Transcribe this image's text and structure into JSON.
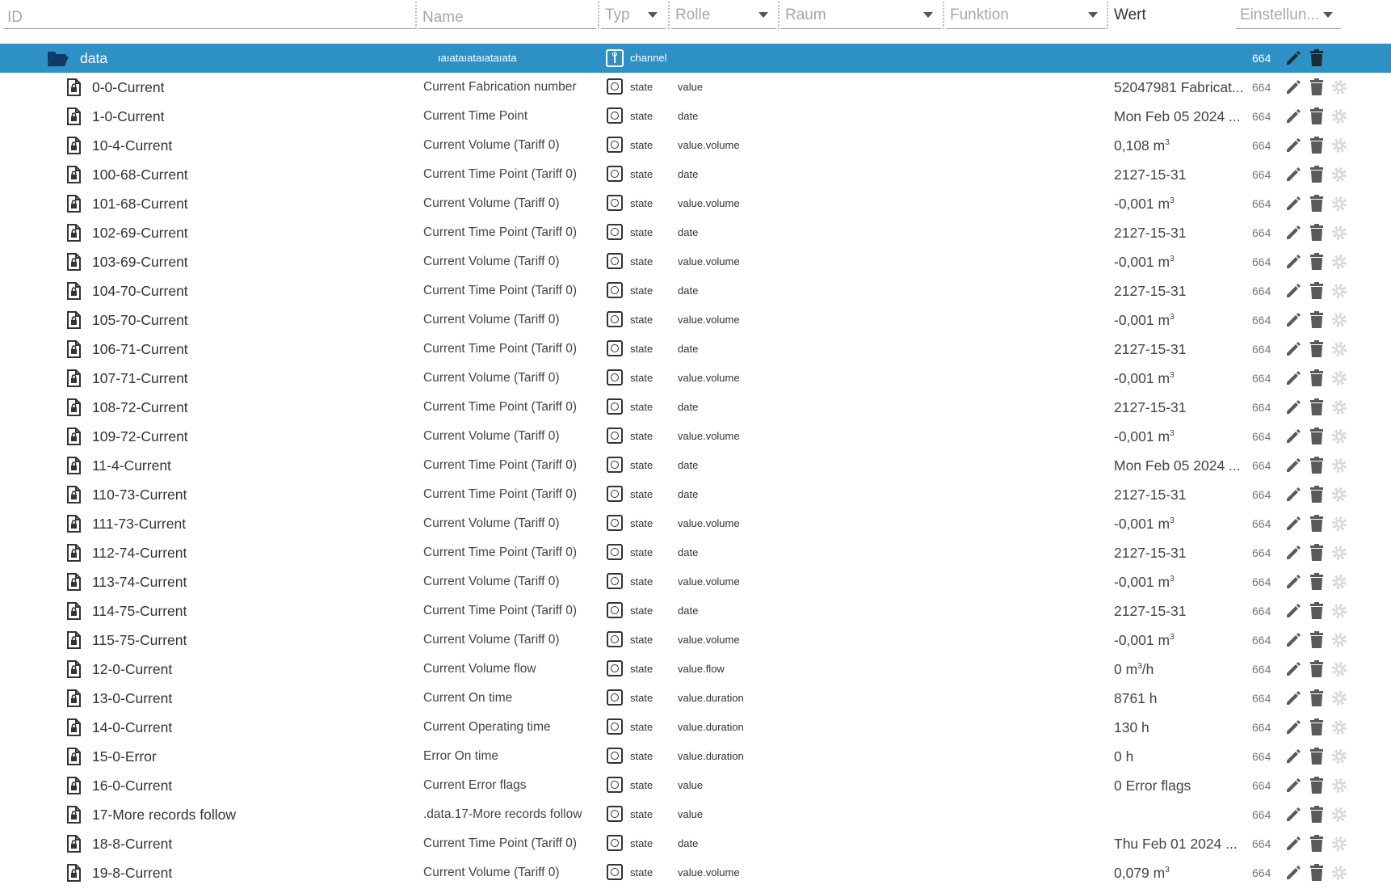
{
  "filters": {
    "id_placeholder": "ID",
    "name_placeholder": "Name",
    "type_label": "Typ",
    "role_label": "Rolle",
    "room_label": "Raum",
    "function_label": "Funktion",
    "value_label": "Wert",
    "settings_label": "Einstellun..."
  },
  "colors": {
    "selected_row": "#2e91c6",
    "icon_dark": "#333333",
    "icon_gear": "#d9d9d9"
  },
  "channel_row": {
    "id": "data",
    "name": "ıaıataıataıataıata",
    "type": "channel",
    "acl": "664"
  },
  "rows": [
    {
      "id": "0-0-Current",
      "name": "Current Fabrication number",
      "type": "state",
      "role": "value",
      "value": "52047981 Fabricat...",
      "unit": "",
      "acl": "664"
    },
    {
      "id": "1-0-Current",
      "name": "Current Time Point",
      "type": "state",
      "role": "date",
      "value": "Mon Feb 05 2024 ...",
      "unit": "",
      "acl": "664"
    },
    {
      "id": "10-4-Current",
      "name": "Current Volume (Tariff 0)",
      "type": "state",
      "role": "value.volume",
      "value": "0,108 m",
      "unit": "3",
      "acl": "664"
    },
    {
      "id": "100-68-Current",
      "name": "Current Time Point (Tariff 0)",
      "type": "state",
      "role": "date",
      "value": "2127-15-31",
      "unit": "",
      "acl": "664"
    },
    {
      "id": "101-68-Current",
      "name": "Current Volume (Tariff 0)",
      "type": "state",
      "role": "value.volume",
      "value": "-0,001 m",
      "unit": "3",
      "acl": "664"
    },
    {
      "id": "102-69-Current",
      "name": "Current Time Point (Tariff 0)",
      "type": "state",
      "role": "date",
      "value": "2127-15-31",
      "unit": "",
      "acl": "664"
    },
    {
      "id": "103-69-Current",
      "name": "Current Volume (Tariff 0)",
      "type": "state",
      "role": "value.volume",
      "value": "-0,001 m",
      "unit": "3",
      "acl": "664"
    },
    {
      "id": "104-70-Current",
      "name": "Current Time Point (Tariff 0)",
      "type": "state",
      "role": "date",
      "value": "2127-15-31",
      "unit": "",
      "acl": "664"
    },
    {
      "id": "105-70-Current",
      "name": "Current Volume (Tariff 0)",
      "type": "state",
      "role": "value.volume",
      "value": "-0,001 m",
      "unit": "3",
      "acl": "664"
    },
    {
      "id": "106-71-Current",
      "name": "Current Time Point (Tariff 0)",
      "type": "state",
      "role": "date",
      "value": "2127-15-31",
      "unit": "",
      "acl": "664"
    },
    {
      "id": "107-71-Current",
      "name": "Current Volume (Tariff 0)",
      "type": "state",
      "role": "value.volume",
      "value": "-0,001 m",
      "unit": "3",
      "acl": "664"
    },
    {
      "id": "108-72-Current",
      "name": "Current Time Point (Tariff 0)",
      "type": "state",
      "role": "date",
      "value": "2127-15-31",
      "unit": "",
      "acl": "664"
    },
    {
      "id": "109-72-Current",
      "name": "Current Volume (Tariff 0)",
      "type": "state",
      "role": "value.volume",
      "value": "-0,001 m",
      "unit": "3",
      "acl": "664"
    },
    {
      "id": "11-4-Current",
      "name": "Current Time Point (Tariff 0)",
      "type": "state",
      "role": "date",
      "value": "Mon Feb 05 2024 ...",
      "unit": "",
      "acl": "664"
    },
    {
      "id": "110-73-Current",
      "name": "Current Time Point (Tariff 0)",
      "type": "state",
      "role": "date",
      "value": "2127-15-31",
      "unit": "",
      "acl": "664"
    },
    {
      "id": "111-73-Current",
      "name": "Current Volume (Tariff 0)",
      "type": "state",
      "role": "value.volume",
      "value": "-0,001 m",
      "unit": "3",
      "acl": "664"
    },
    {
      "id": "112-74-Current",
      "name": "Current Time Point (Tariff 0)",
      "type": "state",
      "role": "date",
      "value": "2127-15-31",
      "unit": "",
      "acl": "664"
    },
    {
      "id": "113-74-Current",
      "name": "Current Volume (Tariff 0)",
      "type": "state",
      "role": "value.volume",
      "value": "-0,001 m",
      "unit": "3",
      "acl": "664"
    },
    {
      "id": "114-75-Current",
      "name": "Current Time Point (Tariff 0)",
      "type": "state",
      "role": "date",
      "value": "2127-15-31",
      "unit": "",
      "acl": "664"
    },
    {
      "id": "115-75-Current",
      "name": "Current Volume (Tariff 0)",
      "type": "state",
      "role": "value.volume",
      "value": "-0,001 m",
      "unit": "3",
      "acl": "664"
    },
    {
      "id": "12-0-Current",
      "name": "Current Volume flow",
      "type": "state",
      "role": "value.flow",
      "value": "0 m",
      "unit": "3",
      "suffix": "/h",
      "acl": "664"
    },
    {
      "id": "13-0-Current",
      "name": "Current On time",
      "type": "state",
      "role": "value.duration",
      "value": "8761 h",
      "unit": "",
      "acl": "664"
    },
    {
      "id": "14-0-Current",
      "name": "Current Operating time",
      "type": "state",
      "role": "value.duration",
      "value": "130 h",
      "unit": "",
      "acl": "664"
    },
    {
      "id": "15-0-Error",
      "name": "Error On time",
      "type": "state",
      "role": "value.duration",
      "value": "0 h",
      "unit": "",
      "acl": "664"
    },
    {
      "id": "16-0-Current",
      "name": "Current Error flags",
      "type": "state",
      "role": "value",
      "value": "0 Error flags",
      "unit": "",
      "acl": "664"
    },
    {
      "id": "17-More records follow",
      "name": ".data.17-More records follow",
      "type": "state",
      "role": "value",
      "value": "",
      "unit": "",
      "acl": "664"
    },
    {
      "id": "18-8-Current",
      "name": "Current Time Point (Tariff 0)",
      "type": "state",
      "role": "date",
      "value": "Thu Feb 01 2024 ...",
      "unit": "",
      "acl": "664"
    },
    {
      "id": "19-8-Current",
      "name": "Current Volume (Tariff 0)",
      "type": "state",
      "role": "value.volume",
      "value": "0,079 m",
      "unit": "3",
      "acl": "664"
    }
  ]
}
